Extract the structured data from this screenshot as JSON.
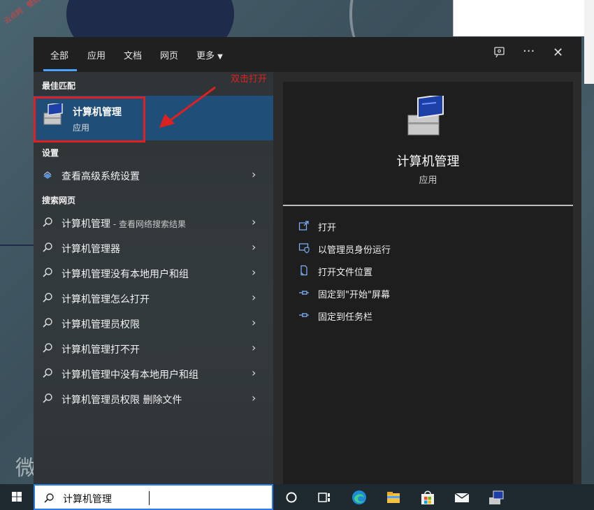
{
  "watermark": "云点网 · 壁纸科技",
  "desktop_glyph": "微",
  "annotation": "双击打开",
  "tabs": [
    {
      "label": "全部",
      "active": true
    },
    {
      "label": "应用"
    },
    {
      "label": "文档"
    },
    {
      "label": "网页"
    },
    {
      "label": "更多"
    }
  ],
  "header_icons": {
    "feedback": "feedback-icon",
    "more": "···",
    "close": "✕"
  },
  "sections": {
    "best_match": "最佳匹配",
    "settings": "设置",
    "web": "搜索网页"
  },
  "best_match": {
    "title": "计算机管理",
    "subtitle": "应用",
    "icon": "computer-management-icon"
  },
  "settings_item": {
    "label": "查看高级系统设置",
    "icon": "system-settings-icon"
  },
  "web_results": [
    {
      "label": "计算机管理",
      "suffix": " - 查看网络搜索结果"
    },
    {
      "label": "计算机管理器",
      "suffix": ""
    },
    {
      "label": "计算机管理没有本地用户和组",
      "suffix": ""
    },
    {
      "label": "计算机管理怎么打开",
      "suffix": ""
    },
    {
      "label": "计算机管理员权限",
      "suffix": ""
    },
    {
      "label": "计算机管理打不开",
      "suffix": ""
    },
    {
      "label": "计算机管理中没有本地用户和组",
      "suffix": ""
    },
    {
      "label": "计算机管理员权限 删除文件",
      "suffix": ""
    }
  ],
  "detail": {
    "title": "计算机管理",
    "subtitle": "应用",
    "actions": [
      {
        "label": "打开",
        "icon": "open-icon"
      },
      {
        "label": "以管理员身份运行",
        "icon": "shield-icon"
      },
      {
        "label": "打开文件位置",
        "icon": "file-location-icon"
      },
      {
        "label": "固定到\"开始\"屏幕",
        "icon": "pin-icon"
      },
      {
        "label": "固定到任务栏",
        "icon": "pin-icon"
      }
    ]
  },
  "search": {
    "value": "计算机管理"
  },
  "colors": {
    "accent": "#4aa3ff",
    "selected": "#1f4e79",
    "highlight": "#e02020"
  }
}
